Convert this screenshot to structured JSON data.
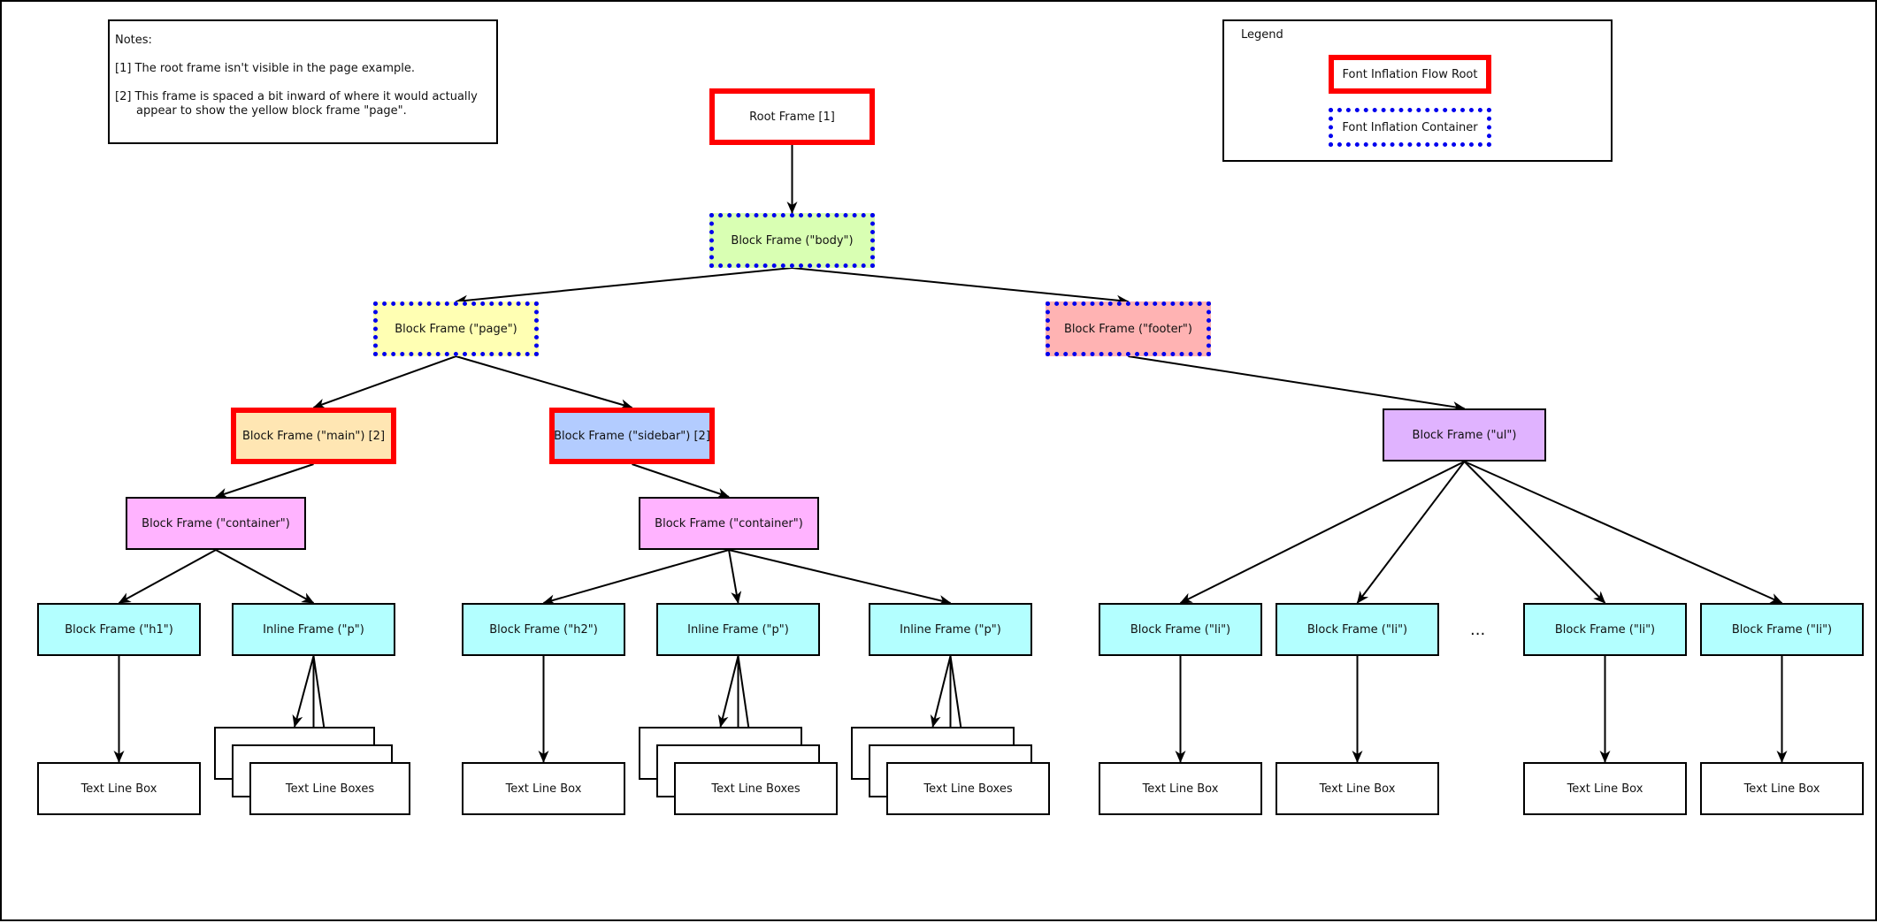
{
  "notes": {
    "heading": "Notes:",
    "items": [
      "[1] The root frame isn't visible in the page example.",
      "[2] This frame is spaced a bit inward of where it would actually appear to show the yellow block frame \"page\"."
    ]
  },
  "legend": {
    "title": "Legend",
    "items": [
      {
        "label": "Font Inflation Flow Root",
        "style": "flow-root"
      },
      {
        "label": "Font Inflation Container",
        "style": "container"
      }
    ]
  },
  "colors": {
    "flow_root_border": "#ff0000",
    "container_border": "#0000ee",
    "body_fill": "#d9ffb3",
    "page_fill": "#ffffb3",
    "footer_fill": "#ffb3b3",
    "main_fill": "#ffe6b3",
    "sidebar_fill": "#b3ccff",
    "container_fill": "#ffb3ff",
    "ul_fill": "#e0b3ff",
    "leaf_frame_fill": "#b3ffff",
    "text_box_fill": "#ffffff"
  },
  "tree": {
    "nodes": [
      {
        "id": "root",
        "label": "Root Frame [1]",
        "style": "flow-root",
        "fill": "#ffffff"
      },
      {
        "id": "body",
        "label": "Block Frame (\"body\")",
        "style": "container",
        "fill": "#d9ffb3"
      },
      {
        "id": "page",
        "label": "Block Frame (\"page\")",
        "style": "container",
        "fill": "#ffffb3"
      },
      {
        "id": "footer",
        "label": "Block Frame (\"footer\")",
        "style": "container",
        "fill": "#ffb3b3"
      },
      {
        "id": "main",
        "label": "Block Frame (\"main\") [2]",
        "style": "flow-root",
        "fill": "#ffe6b3"
      },
      {
        "id": "sidebar",
        "label": "Block Frame (\"sidebar\") [2]",
        "style": "flow-root",
        "fill": "#b3ccff"
      },
      {
        "id": "ul",
        "label": "Block Frame (\"ul\")",
        "style": "plain",
        "fill": "#e0b3ff"
      },
      {
        "id": "container1",
        "label": "Block Frame (\"container\")",
        "style": "plain",
        "fill": "#ffb3ff"
      },
      {
        "id": "container2",
        "label": "Block Frame (\"container\")",
        "style": "plain",
        "fill": "#ffb3ff"
      },
      {
        "id": "h1",
        "label": "Block Frame (\"h1\")",
        "style": "plain",
        "fill": "#b3ffff"
      },
      {
        "id": "p1",
        "label": "Inline Frame (\"p\")",
        "style": "plain",
        "fill": "#b3ffff"
      },
      {
        "id": "h2",
        "label": "Block Frame (\"h2\")",
        "style": "plain",
        "fill": "#b3ffff"
      },
      {
        "id": "p2",
        "label": "Inline Frame (\"p\")",
        "style": "plain",
        "fill": "#b3ffff"
      },
      {
        "id": "p3",
        "label": "Inline Frame (\"p\")",
        "style": "plain",
        "fill": "#b3ffff"
      },
      {
        "id": "li1",
        "label": "Block Frame (\"li\")",
        "style": "plain",
        "fill": "#b3ffff"
      },
      {
        "id": "li2",
        "label": "Block Frame (\"li\")",
        "style": "plain",
        "fill": "#b3ffff"
      },
      {
        "id": "li3",
        "label": "Block Frame (\"li\")",
        "style": "plain",
        "fill": "#b3ffff"
      },
      {
        "id": "li4",
        "label": "Block Frame (\"li\")",
        "style": "plain",
        "fill": "#b3ffff"
      },
      {
        "id": "tlb_h1",
        "label": "Text Line Box",
        "style": "plain",
        "fill": "#ffffff"
      },
      {
        "id": "tlbs_p1",
        "label": "Text Line Boxes",
        "style": "stack",
        "fill": "#ffffff"
      },
      {
        "id": "tlb_h2",
        "label": "Text Line Box",
        "style": "plain",
        "fill": "#ffffff"
      },
      {
        "id": "tlbs_p2",
        "label": "Text Line Boxes",
        "style": "stack",
        "fill": "#ffffff"
      },
      {
        "id": "tlbs_p3",
        "label": "Text Line Boxes",
        "style": "stack",
        "fill": "#ffffff"
      },
      {
        "id": "tlb_li1",
        "label": "Text Line Box",
        "style": "plain",
        "fill": "#ffffff"
      },
      {
        "id": "tlb_li2",
        "label": "Text Line Box",
        "style": "plain",
        "fill": "#ffffff"
      },
      {
        "id": "tlb_li3",
        "label": "Text Line Box",
        "style": "plain",
        "fill": "#ffffff"
      },
      {
        "id": "tlb_li4",
        "label": "Text Line Box",
        "style": "plain",
        "fill": "#ffffff"
      }
    ],
    "edges": [
      [
        "root",
        "body"
      ],
      [
        "body",
        "page"
      ],
      [
        "body",
        "footer"
      ],
      [
        "page",
        "main"
      ],
      [
        "page",
        "sidebar"
      ],
      [
        "footer",
        "ul"
      ],
      [
        "main",
        "container1"
      ],
      [
        "sidebar",
        "container2"
      ],
      [
        "container1",
        "h1"
      ],
      [
        "container1",
        "p1"
      ],
      [
        "container2",
        "h2"
      ],
      [
        "container2",
        "p2"
      ],
      [
        "container2",
        "p3"
      ],
      [
        "ul",
        "li1"
      ],
      [
        "ul",
        "li2"
      ],
      [
        "ul",
        "li3"
      ],
      [
        "ul",
        "li4"
      ],
      [
        "h1",
        "tlb_h1"
      ],
      [
        "p1",
        "tlbs_p1"
      ],
      [
        "h2",
        "tlb_h2"
      ],
      [
        "p2",
        "tlbs_p2"
      ],
      [
        "p3",
        "tlbs_p3"
      ],
      [
        "li1",
        "tlb_li1"
      ],
      [
        "li2",
        "tlb_li2"
      ],
      [
        "li3",
        "tlb_li3"
      ],
      [
        "li4",
        "tlb_li4"
      ]
    ],
    "ellipsis": "..."
  }
}
